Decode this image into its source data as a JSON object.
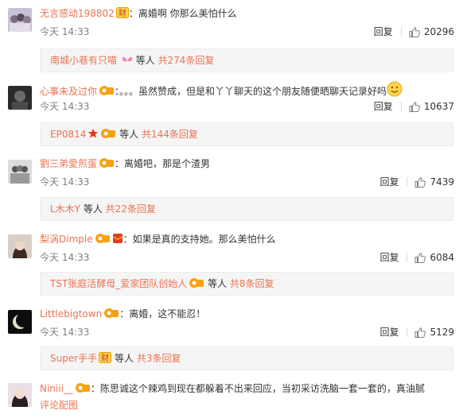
{
  "comments": [
    {
      "user": "无言感动198802",
      "badge": "财",
      "text": "：离婚啊 你那么美怕什么",
      "time": "今天 14:33",
      "reply": "回复",
      "likes": "20296",
      "sub_user": "南城小巷有只喵",
      "sub_mid": " 等人 ",
      "sub_total": "共274条回复"
    },
    {
      "user": "心事未及过你",
      "text": "：。。。虽然赞成，但是和丫丫聊天的这个朋友随便晒聊天记录好吗",
      "time": "今天 14:33",
      "reply": "回复",
      "likes": "10637",
      "sub_user": "EP0814",
      "sub_mid": " 等人 ",
      "sub_total": "共144条回复"
    },
    {
      "user": "劉三弟愛煎蛋",
      "text": "：离婚吧，那是个渣男",
      "time": "今天 14:33",
      "reply": "回复",
      "likes": "7439",
      "sub_user": "L木木Y",
      "sub_mid": " 等人 ",
      "sub_total": "共22条回复"
    },
    {
      "user": "梨涡Dimple",
      "text": "：如果是真的支持她。那么美怕什么",
      "time": "今天 14:33",
      "reply": "回复",
      "likes": "6084",
      "sub_user": "TST张庭活酵母_爱家团队创始人",
      "sub_mid": " 等人 ",
      "sub_total": "共8条回复"
    },
    {
      "user": "Littlebigtown",
      "text": "：离婚，这不能忍！",
      "time": "今天 14:33",
      "reply": "回复",
      "likes": "5129",
      "sub_user": "Super手手",
      "sub_badge": "财",
      "sub_mid": " 等人 ",
      "sub_total": "共3条回复"
    },
    {
      "user": "Niniii__",
      "text": "：陈思诚这个辣鸡到现在都躲着不出来回应，当初采访洗脑一套一套的，真油腻",
      "link": "评论配图"
    }
  ],
  "colors": {
    "username": "#eb7350",
    "subbox_bg": "#f5f5f5",
    "time": "#808080"
  }
}
